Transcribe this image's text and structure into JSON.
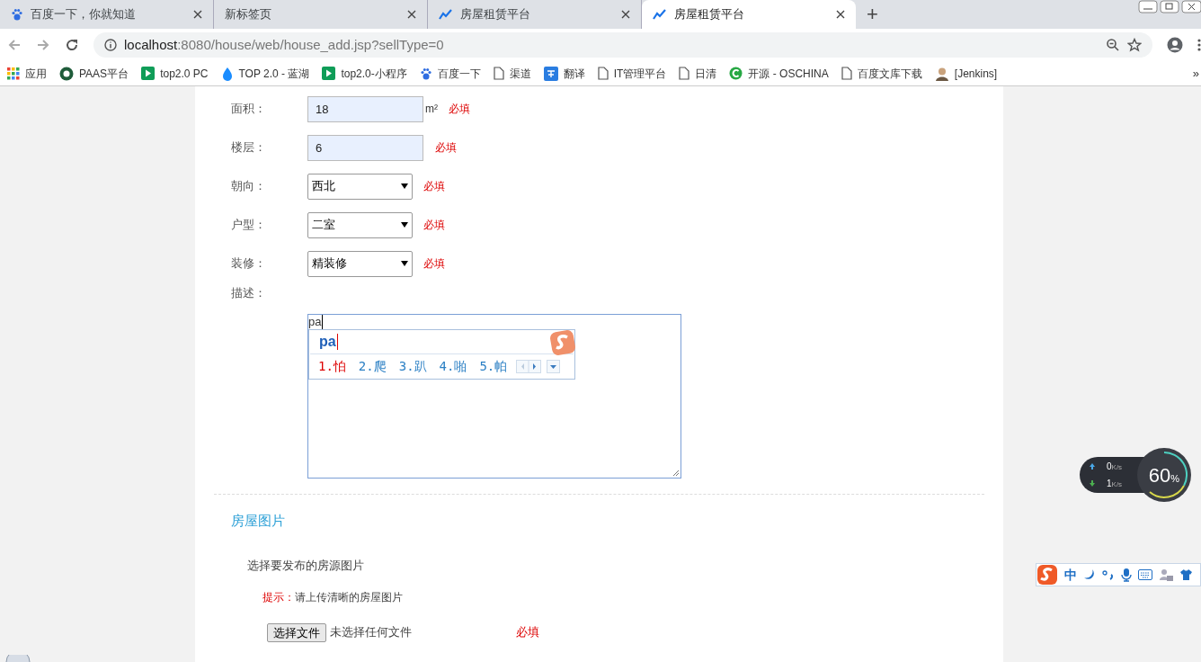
{
  "tabs": [
    {
      "title": "百度一下，你就知道",
      "kind": "paw",
      "selected": false
    },
    {
      "title": "新标签页",
      "selected": false
    },
    {
      "title": "房屋租赁平台",
      "kind": "chart",
      "selected": false
    },
    {
      "title": "房屋租赁平台",
      "kind": "chart",
      "selected": true
    }
  ],
  "new_tab": "+",
  "address": {
    "host": "localhost",
    "rest": ":8080/house/web/house_add.jsp?sellType=0"
  },
  "bookmarks": [
    {
      "label": "应用",
      "kind": "apps"
    },
    {
      "label": "PAAS平台",
      "kind": "circle"
    },
    {
      "label": "top2.0 PC",
      "kind": "play"
    },
    {
      "label": "TOP 2.0 - 蓝湖",
      "kind": "drop"
    },
    {
      "label": "top2.0-小程序",
      "kind": "play"
    },
    {
      "label": "百度一下",
      "kind": "paw"
    },
    {
      "label": "渠道",
      "kind": "page"
    },
    {
      "label": "翻译",
      "kind": "translate"
    },
    {
      "label": "IT管理平台",
      "kind": "page"
    },
    {
      "label": "日清",
      "kind": "page"
    },
    {
      "label": "开源 - OSCHINA",
      "kind": "c"
    },
    {
      "label": "百度文库下载",
      "kind": "page"
    },
    {
      "label": "[Jenkins]",
      "kind": "person"
    }
  ],
  "bookmarks_more": "»",
  "form": [
    {
      "label": "面积：",
      "kind": "input",
      "value": "18",
      "unit": "m²",
      "required": "必填"
    },
    {
      "label": "楼层：",
      "kind": "input",
      "value": "6",
      "required": "必填"
    },
    {
      "label": "朝向：",
      "kind": "select",
      "value": "西北",
      "required": "必填"
    },
    {
      "label": "户型：",
      "kind": "select",
      "value": "二室",
      "required": "必填"
    },
    {
      "label": "装修：",
      "kind": "select",
      "value": "精装修",
      "required": "必填"
    },
    {
      "label": "描述：",
      "kind": "textarea",
      "value": "pa"
    }
  ],
  "ime": {
    "composition": "pa",
    "candidates": [
      {
        "text": "1.怕",
        "selected": true
      },
      {
        "text": "2.爬",
        "selected": false
      },
      {
        "text": "3.趴",
        "selected": false
      },
      {
        "text": "4.啪",
        "selected": false
      },
      {
        "text": "5.帕",
        "selected": false
      }
    ]
  },
  "photos": {
    "title": "房屋图片",
    "subtitle": "选择要发布的房源图片",
    "hint_label": "提示：",
    "hint": "请上传清晰的房屋图片",
    "file_button": "选择文件",
    "file_status": "未选择任何文件",
    "required": "必填"
  },
  "net_widget": {
    "up": "0",
    "up_unit": "K/s",
    "down": "1",
    "down_unit": "K/s",
    "percent": "60",
    "percent_sign": "%"
  },
  "ime_toolbar": {
    "mode": "中"
  }
}
